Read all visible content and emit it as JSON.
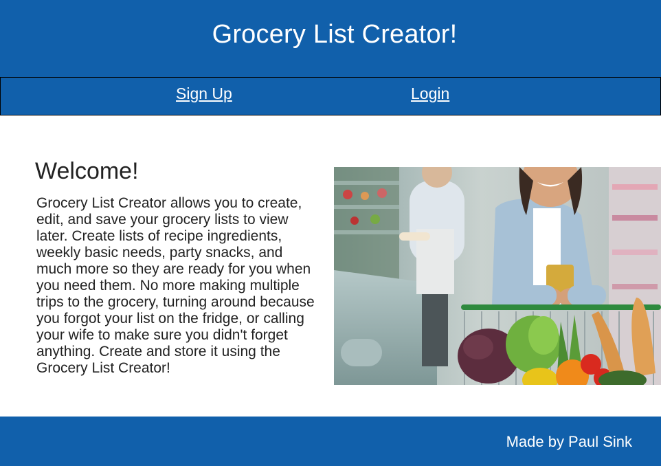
{
  "header": {
    "title": "Grocery List Creator!"
  },
  "nav": {
    "signup_label": "Sign Up",
    "login_label": "Login"
  },
  "welcome": {
    "heading": "Welcome!",
    "body": "Grocery List Creator allows you to create, edit, and save your grocery lists to view later. Create lists of recipe ingredients, weekly basic needs, party snacks, and much more so they are ready for you when you need them. No more making multiple trips to the grocery, turning around because you forgot your list on the fridge, or calling your wife to make sure you didn't forget anything. Create and store it using the Grocery List Creator!"
  },
  "hero_image": {
    "subject": "woman-with-phone-and-grocery-cart-photo"
  },
  "footer": {
    "credit": "Made by Paul Sink"
  },
  "colors": {
    "brand_blue": "#1160ab",
    "text_dark": "#222222",
    "white": "#ffffff"
  }
}
